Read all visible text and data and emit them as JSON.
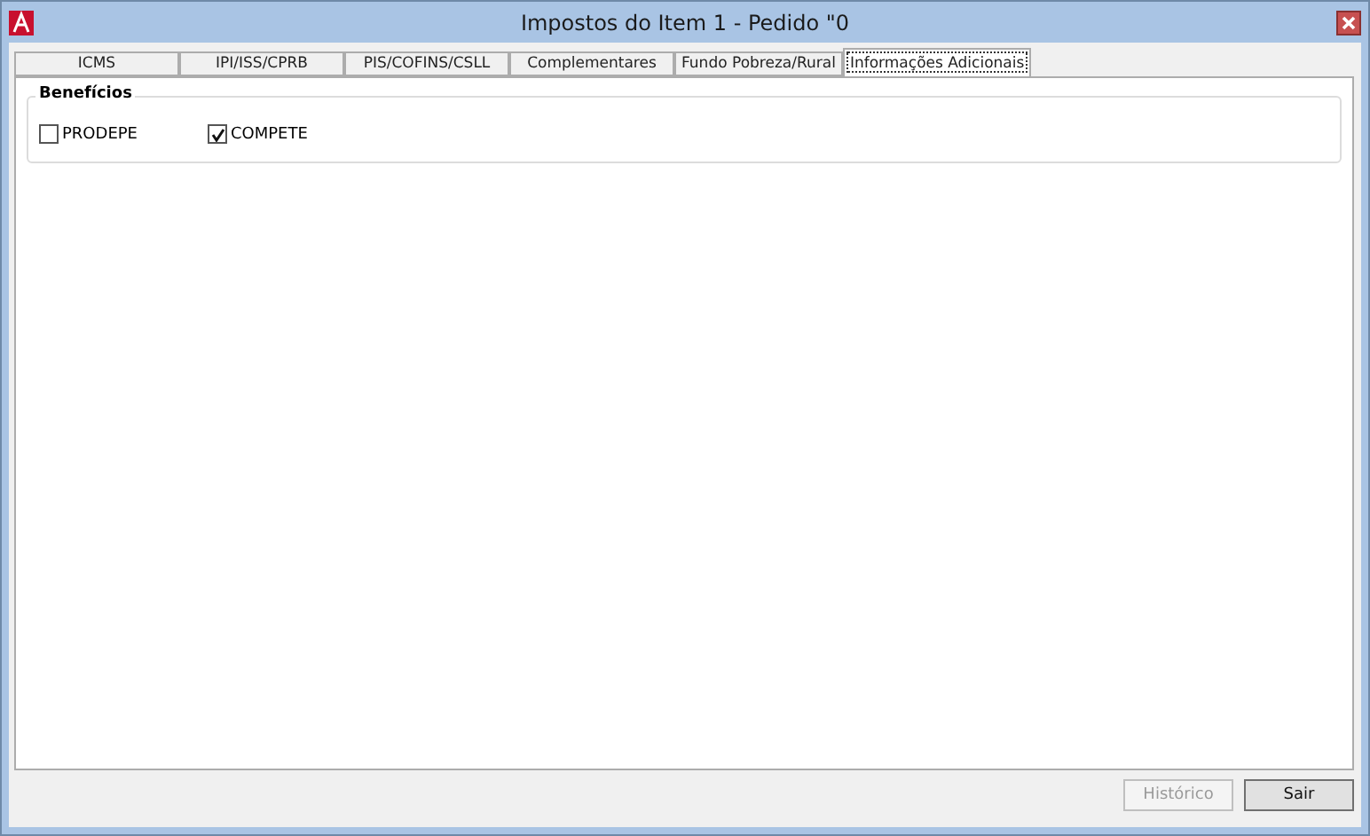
{
  "window": {
    "title": "Impostos do Item 1 - Pedido \"0"
  },
  "tabs": [
    {
      "label": "ICMS",
      "selected": false
    },
    {
      "label": "IPI/ISS/CPRB",
      "selected": false
    },
    {
      "label": "PIS/COFINS/CSLL",
      "selected": false
    },
    {
      "label": "Complementares",
      "selected": false
    },
    {
      "label": "Fundo Pobreza/Rural",
      "selected": false
    },
    {
      "label": "Informações Adicionais",
      "selected": true
    }
  ],
  "group": {
    "title": "Benefícios",
    "checkboxes": [
      {
        "label": "PRODEPE",
        "checked": false
      },
      {
        "label": "COMPETE",
        "checked": true
      }
    ]
  },
  "buttons": [
    {
      "label": "Histórico",
      "disabled": true
    },
    {
      "label": "Sair",
      "disabled": false
    }
  ]
}
